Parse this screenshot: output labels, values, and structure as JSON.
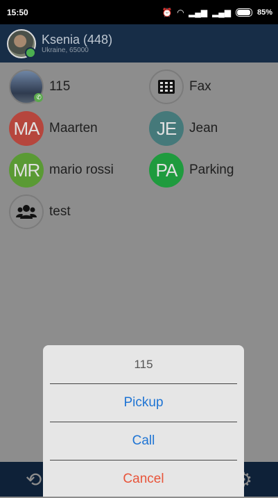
{
  "status_bar": {
    "time": "15:50",
    "battery": "85%",
    "icons": [
      "alarm-icon",
      "wifi-icon",
      "signal-icon",
      "signal-icon",
      "battery-icon"
    ]
  },
  "header": {
    "name": "Ksenia (448)",
    "subtitle": "Ukraine, 65000"
  },
  "contacts": [
    {
      "label": "115",
      "avatar": "photo",
      "initials": ""
    },
    {
      "label": "Fax",
      "avatar": "keypad-icon",
      "initials": ""
    },
    {
      "label": "Maarten",
      "avatar": "initials",
      "initials": "MA",
      "color": "#b6463d"
    },
    {
      "label": "Jean",
      "avatar": "initials",
      "initials": "JE",
      "color": "#45797a"
    },
    {
      "label": "mario rossi",
      "avatar": "initials",
      "initials": "MR",
      "color": "#5a9a34"
    },
    {
      "label": "Parking",
      "avatar": "initials",
      "initials": "PA",
      "color": "#1f9b3e"
    },
    {
      "label": "test",
      "avatar": "group-icon",
      "initials": ""
    }
  ],
  "dialog": {
    "title": "115",
    "pickup": "Pickup",
    "call": "Call",
    "cancel": "Cancel"
  },
  "bottom_nav": {
    "icons": [
      "history-icon",
      "notes-icon",
      "chat-icon",
      "settings-icon"
    ]
  }
}
